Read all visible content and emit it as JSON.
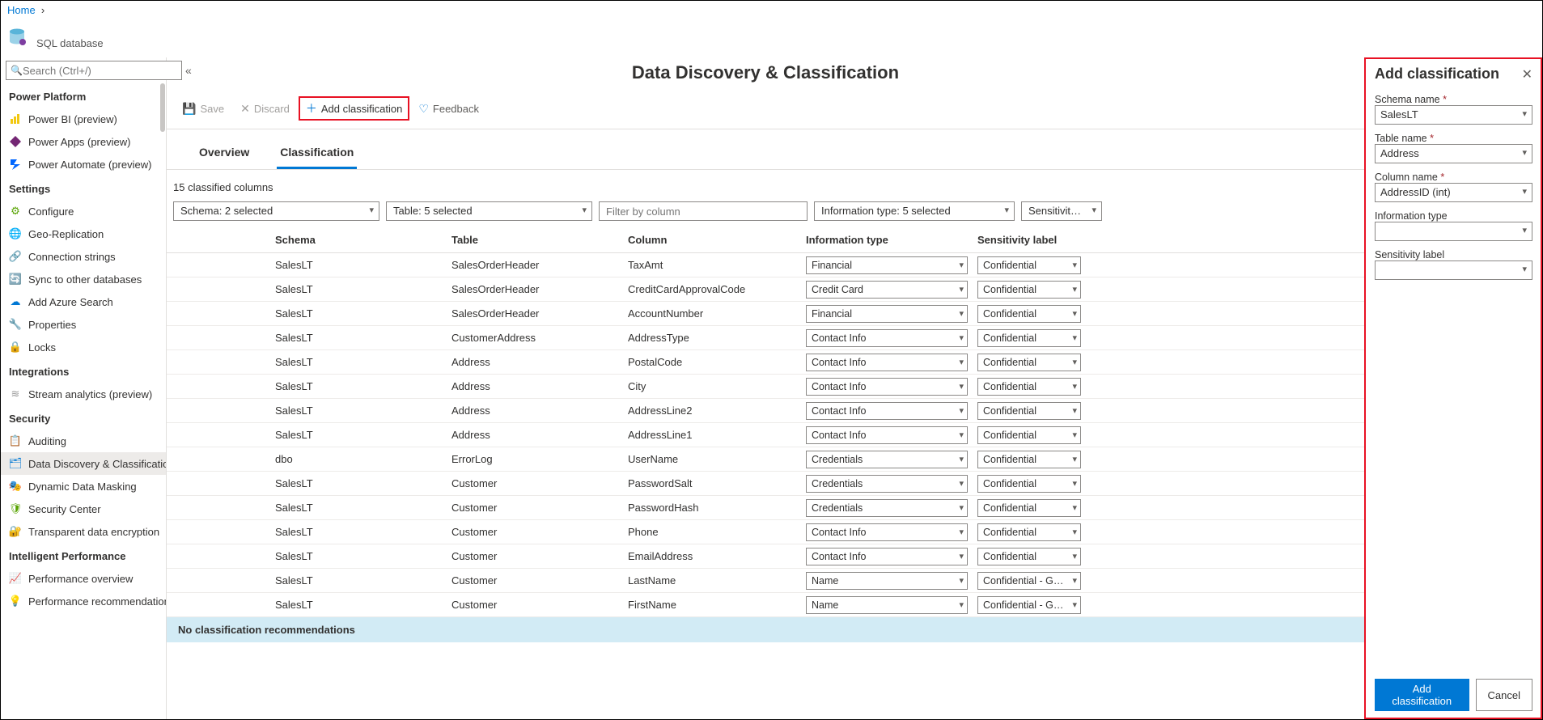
{
  "breadcrumb": {
    "home": "Home"
  },
  "resource": {
    "caption": "SQL database"
  },
  "search": {
    "placeholder": "Search (Ctrl+/)"
  },
  "sidebar": {
    "groups": [
      {
        "title": "Power Platform",
        "items": [
          {
            "label": "Power BI (preview)"
          },
          {
            "label": "Power Apps (preview)"
          },
          {
            "label": "Power Automate (preview)"
          }
        ]
      },
      {
        "title": "Settings",
        "items": [
          {
            "label": "Configure"
          },
          {
            "label": "Geo-Replication"
          },
          {
            "label": "Connection strings"
          },
          {
            "label": "Sync to other databases"
          },
          {
            "label": "Add Azure Search"
          },
          {
            "label": "Properties"
          },
          {
            "label": "Locks"
          }
        ]
      },
      {
        "title": "Integrations",
        "items": [
          {
            "label": "Stream analytics (preview)"
          }
        ]
      },
      {
        "title": "Security",
        "items": [
          {
            "label": "Auditing"
          },
          {
            "label": "Data Discovery & Classification"
          },
          {
            "label": "Dynamic Data Masking"
          },
          {
            "label": "Security Center"
          },
          {
            "label": "Transparent data encryption"
          }
        ]
      },
      {
        "title": "Intelligent Performance",
        "items": [
          {
            "label": "Performance overview"
          },
          {
            "label": "Performance recommendations"
          }
        ]
      }
    ]
  },
  "page": {
    "title": "Data Discovery & Classification"
  },
  "toolbar": {
    "save": "Save",
    "discard": "Discard",
    "add": "Add classification",
    "feedback": "Feedback"
  },
  "tabs": {
    "overview": "Overview",
    "classification": "Classification"
  },
  "count_text": "15 classified columns",
  "filters": {
    "schema": "Schema: 2 selected",
    "table": "Table: 5 selected",
    "column_placeholder": "Filter by column",
    "info_type": "Information type: 5 selected",
    "sensitivity": "Sensitivity label"
  },
  "columns": {
    "schema": "Schema",
    "table": "Table",
    "column": "Column",
    "info": "Information type",
    "sens": "Sensitivity label"
  },
  "rows": [
    {
      "schema": "SalesLT",
      "table": "SalesOrderHeader",
      "column": "TaxAmt",
      "info": "Financial",
      "sens": "Confidential"
    },
    {
      "schema": "SalesLT",
      "table": "SalesOrderHeader",
      "column": "CreditCardApprovalCode",
      "info": "Credit Card",
      "sens": "Confidential"
    },
    {
      "schema": "SalesLT",
      "table": "SalesOrderHeader",
      "column": "AccountNumber",
      "info": "Financial",
      "sens": "Confidential"
    },
    {
      "schema": "SalesLT",
      "table": "CustomerAddress",
      "column": "AddressType",
      "info": "Contact Info",
      "sens": "Confidential"
    },
    {
      "schema": "SalesLT",
      "table": "Address",
      "column": "PostalCode",
      "info": "Contact Info",
      "sens": "Confidential"
    },
    {
      "schema": "SalesLT",
      "table": "Address",
      "column": "City",
      "info": "Contact Info",
      "sens": "Confidential"
    },
    {
      "schema": "SalesLT",
      "table": "Address",
      "column": "AddressLine2",
      "info": "Contact Info",
      "sens": "Confidential"
    },
    {
      "schema": "SalesLT",
      "table": "Address",
      "column": "AddressLine1",
      "info": "Contact Info",
      "sens": "Confidential"
    },
    {
      "schema": "dbo",
      "table": "ErrorLog",
      "column": "UserName",
      "info": "Credentials",
      "sens": "Confidential"
    },
    {
      "schema": "SalesLT",
      "table": "Customer",
      "column": "PasswordSalt",
      "info": "Credentials",
      "sens": "Confidential"
    },
    {
      "schema": "SalesLT",
      "table": "Customer",
      "column": "PasswordHash",
      "info": "Credentials",
      "sens": "Confidential"
    },
    {
      "schema": "SalesLT",
      "table": "Customer",
      "column": "Phone",
      "info": "Contact Info",
      "sens": "Confidential"
    },
    {
      "schema": "SalesLT",
      "table": "Customer",
      "column": "EmailAddress",
      "info": "Contact Info",
      "sens": "Confidential"
    },
    {
      "schema": "SalesLT",
      "table": "Customer",
      "column": "LastName",
      "info": "Name",
      "sens": "Confidential - GDPR"
    },
    {
      "schema": "SalesLT",
      "table": "Customer",
      "column": "FirstName",
      "info": "Name",
      "sens": "Confidential - GDPR"
    }
  ],
  "rec_bar": "No classification recommendations",
  "panel": {
    "title": "Add classification",
    "schema_label": "Schema name",
    "schema_value": "SalesLT",
    "table_label": "Table name",
    "table_value": "Address",
    "column_label": "Column name",
    "column_value": "AddressID (int)",
    "info_label": "Information type",
    "info_value": "",
    "sens_label": "Sensitivity label",
    "sens_value": "",
    "required_mark": "*",
    "add_btn": "Add classification",
    "cancel_btn": "Cancel"
  }
}
